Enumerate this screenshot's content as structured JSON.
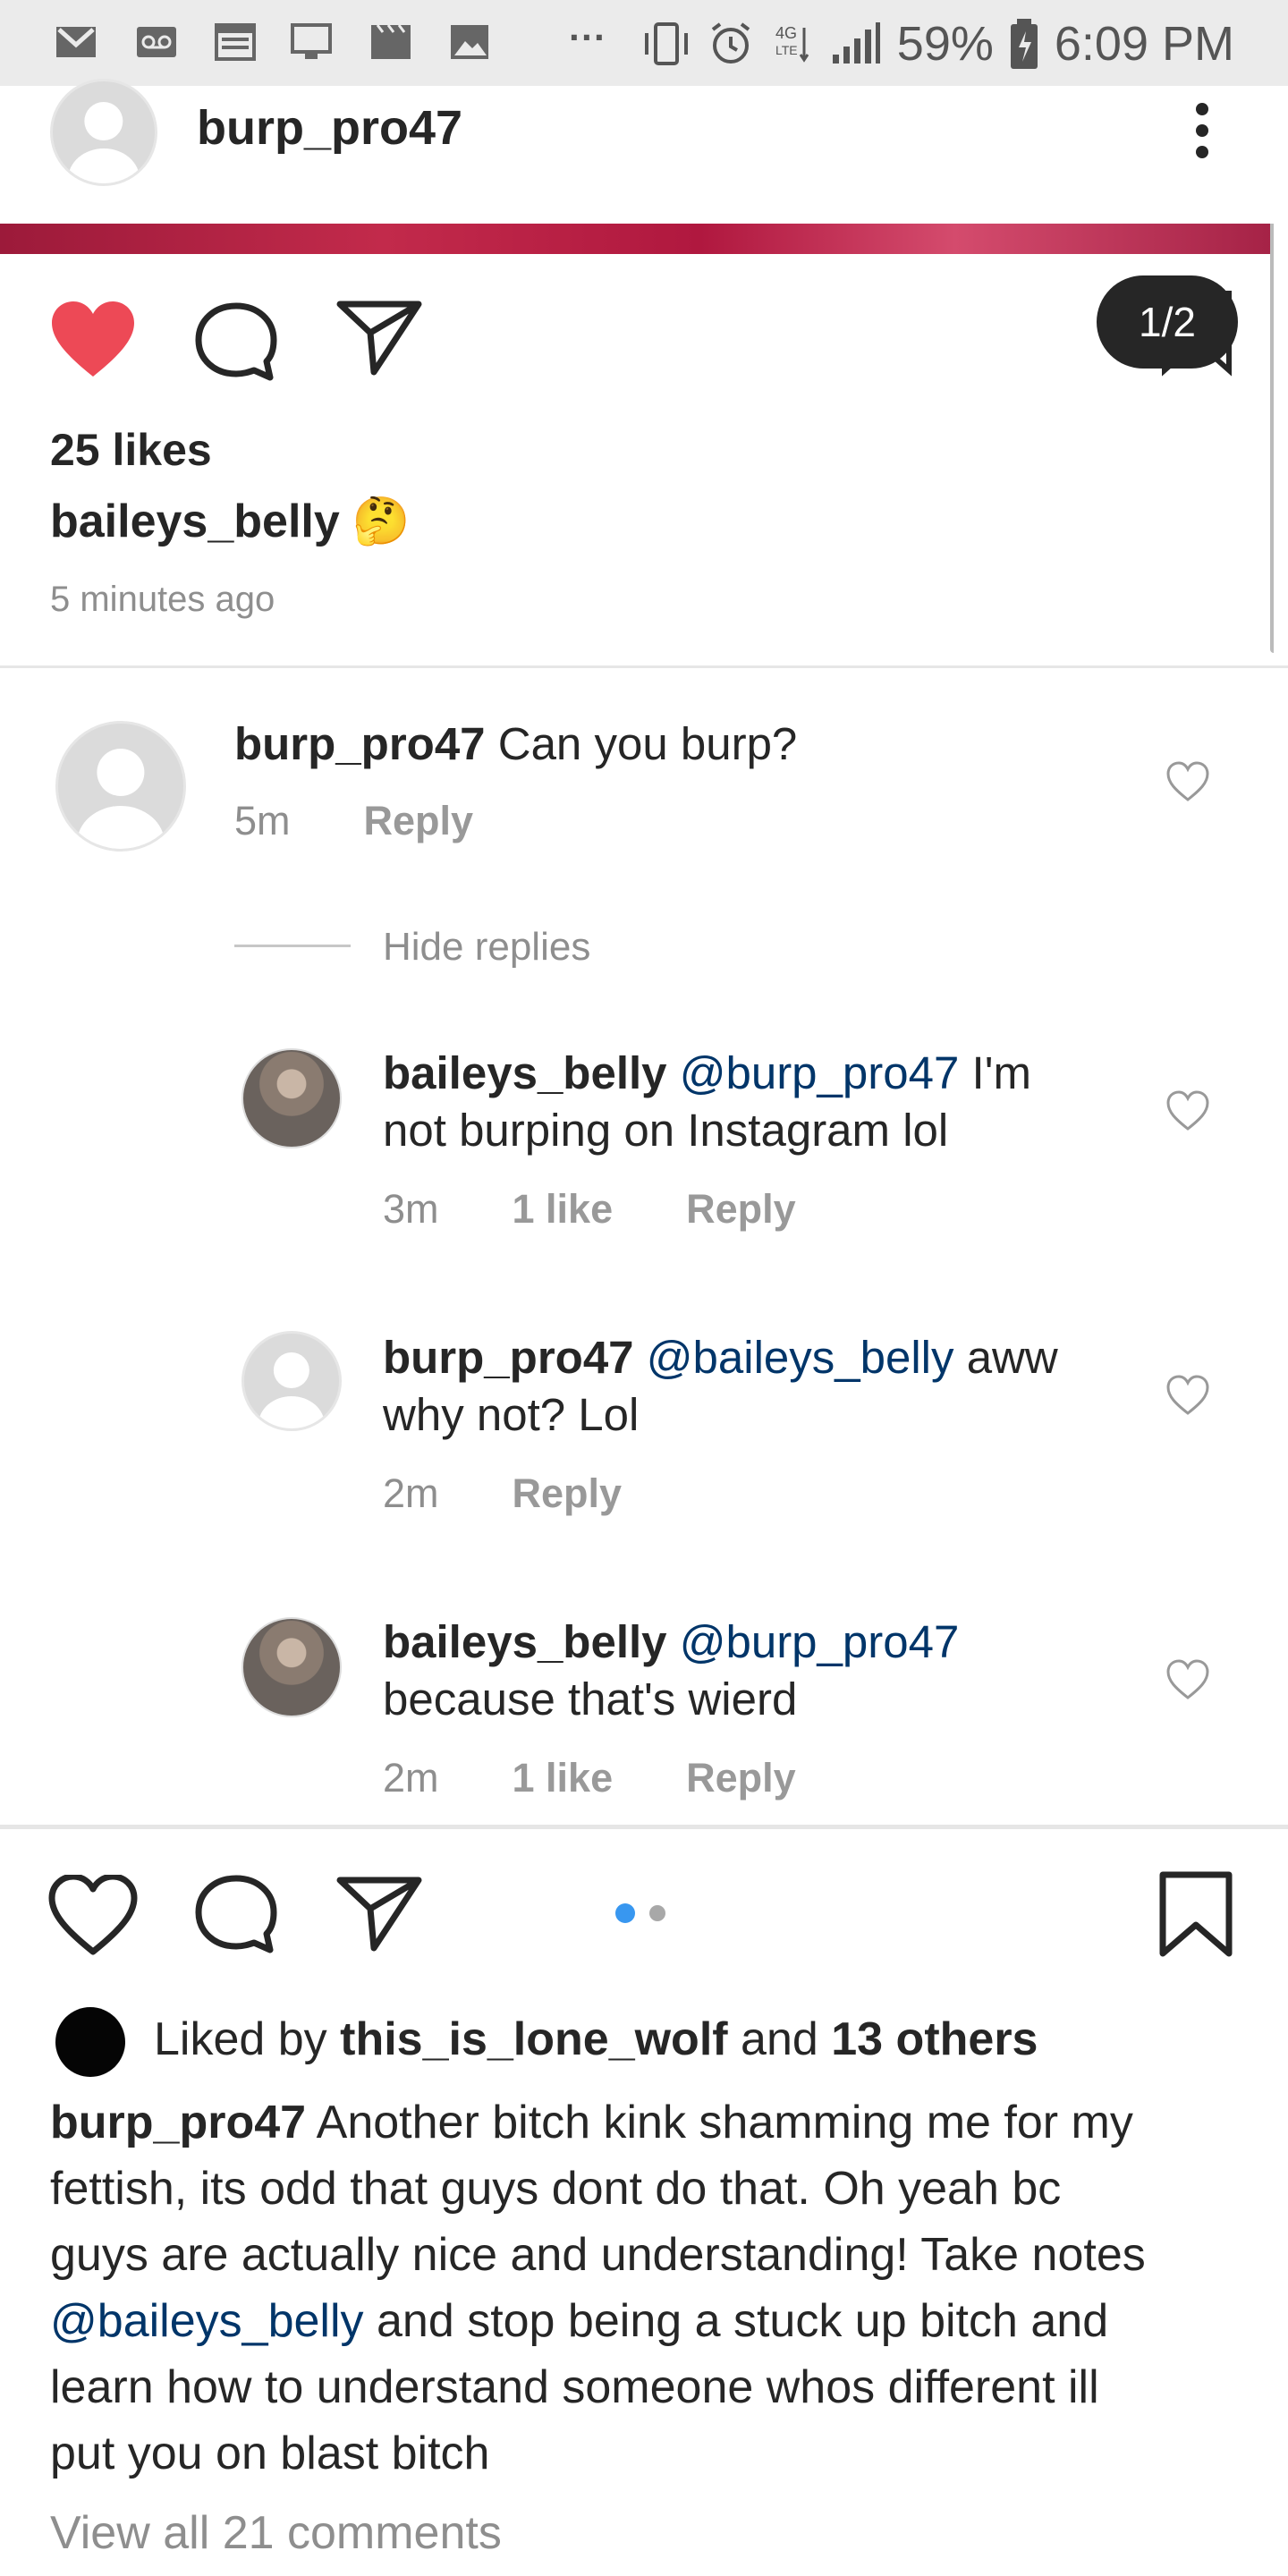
{
  "status_bar": {
    "battery": "59%",
    "time": "6:09 PM",
    "more": "···"
  },
  "header": {
    "username": "burp_pro47"
  },
  "top_post": {
    "counter": "1/2",
    "likes": "25 likes",
    "caption_user": "baileys_belly",
    "caption_emoji": "🤔",
    "timestamp": "5 minutes ago"
  },
  "comments": [
    {
      "user": "burp_pro47",
      "text": "Can you burp?",
      "time": "5m",
      "reply": "Reply"
    }
  ],
  "hide_replies": "Hide replies",
  "replies": [
    {
      "user": "baileys_belly",
      "mention": "@burp_pro47",
      "text_line1_rest": "I'm",
      "text_line2": "not burping on Instagram lol",
      "time": "3m",
      "likes": "1 like",
      "reply": "Reply"
    },
    {
      "user": "burp_pro47",
      "mention": "@baileys_belly",
      "text_line1_rest": "aww",
      "text_line2": "why not? Lol",
      "time": "2m",
      "reply": "Reply"
    },
    {
      "user": "baileys_belly",
      "mention": "@burp_pro47",
      "text_line1_rest": "",
      "text_line2": "because that's wierd",
      "time": "2m",
      "likes": "1 like",
      "reply": "Reply"
    }
  ],
  "bottom_post": {
    "liked_by_prefix": "Liked by",
    "liked_by_user": "this_is_lone_wolf",
    "liked_by_and": "and",
    "liked_by_others": "13 others",
    "caption_user": "burp_pro47",
    "caption_line1": "Another bitch kink shamming me for my",
    "caption_line2": "fettish, its odd that guys dont do that. Oh yeah bc",
    "caption_line3": "guys are actually nice and understanding! Take notes",
    "caption_mention": "@baileys_belly",
    "caption_line4_rest": "and stop being a stuck up bitch and",
    "caption_line5": "learn how to understand someone whos different ill",
    "caption_line6": "put you on blast bitch",
    "view_all": "View all 21 comments"
  },
  "colors": {
    "like_red": "#ed4956",
    "mention_blue": "#003569",
    "dot_active": "#3897f0",
    "dot_inactive": "#a8a8a8",
    "counter_bg": "#262626"
  }
}
